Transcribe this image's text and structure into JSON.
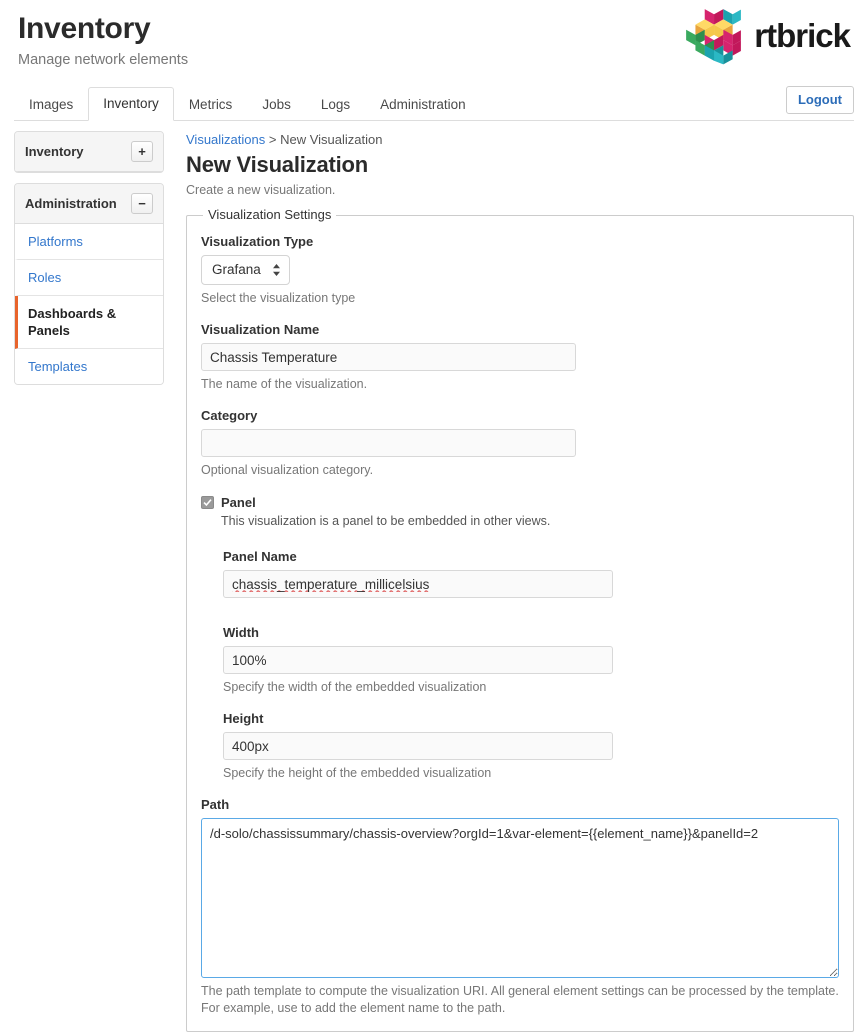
{
  "header": {
    "title": "Inventory",
    "subtitle": "Manage network elements",
    "brand_name": "rtbrick",
    "logo_icon": "rtbrick-isometric-cubes-logo",
    "brand_colors": {
      "magenta": "#d6246e",
      "teal": "#1ba3ae",
      "orange": "#e8a33d",
      "yellow": "#f5c84b",
      "green": "#3aa95f",
      "dark_pink": "#c2185b"
    }
  },
  "tabs": [
    {
      "label": "Images",
      "active": false
    },
    {
      "label": "Inventory",
      "active": true
    },
    {
      "label": "Metrics",
      "active": false
    },
    {
      "label": "Jobs",
      "active": false
    },
    {
      "label": "Logs",
      "active": false
    },
    {
      "label": "Administration",
      "active": false
    }
  ],
  "logout": {
    "label": "Logout"
  },
  "sidebar": {
    "panels": [
      {
        "title": "Inventory",
        "toggle_icon": "plus-icon",
        "toggle_label": "+",
        "expanded": false,
        "items": []
      },
      {
        "title": "Administration",
        "toggle_icon": "minus-icon",
        "toggle_label": "−",
        "expanded": true,
        "items": [
          {
            "label": "Platforms",
            "active": false
          },
          {
            "label": "Roles",
            "active": false
          },
          {
            "label": "Dashboards & Panels",
            "active": true
          },
          {
            "label": "Templates",
            "active": false
          }
        ]
      }
    ],
    "active_accent_color": "#e8642c"
  },
  "content": {
    "breadcrumb": {
      "link_label": "Visualizations",
      "separator": ">",
      "current_label": "New Visualization"
    },
    "page_title": "New Visualization",
    "page_description": "Create a new visualization.",
    "fieldset_legend": "Visualization Settings",
    "fields": {
      "visualization_type": {
        "label": "Visualization Type",
        "value": "Grafana",
        "help": "Select the visualization type",
        "control_icon": "updown-chevrons-icon"
      },
      "visualization_name": {
        "label": "Visualization Name",
        "value": "Chassis Temperature",
        "placeholder": "",
        "help": "The name of the visualization."
      },
      "category": {
        "label": "Category",
        "value": "",
        "placeholder": "",
        "help": "Optional visualization category."
      },
      "panel": {
        "label": "Panel",
        "checked": true,
        "check_icon": "checkmark-icon",
        "help": "This visualization is a panel to be embedded in other views."
      },
      "panel_name": {
        "label": "Panel Name",
        "value": "chassis_temperature_millicelsius",
        "placeholder": "",
        "spellcheck_flagged": true
      },
      "width": {
        "label": "Width",
        "value": "100%",
        "placeholder": "",
        "help": "Specify the width of the embedded visualization"
      },
      "height": {
        "label": "Height",
        "value": "400px",
        "placeholder": "",
        "help": "Specify the height of the embedded visualization"
      },
      "path": {
        "label": "Path",
        "value": "/d-solo/chassissummary/chassis-overview?orgId=1&var-element={{element_name}}&panelId=2",
        "placeholder": "",
        "focused": true,
        "resize_handle_icon": "resize-grip-icon",
        "help": "The path template to compute the visualization URI. All general element settings can be processed by the template. For example, use to add the element name to the path."
      }
    }
  }
}
